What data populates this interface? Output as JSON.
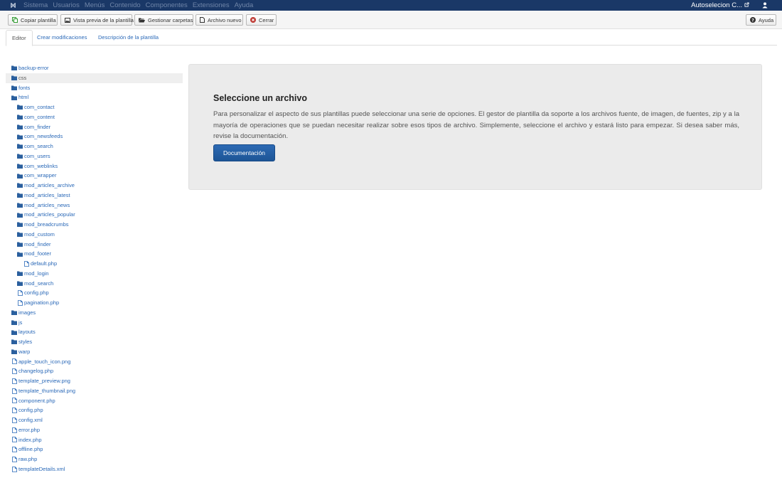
{
  "navbar": {
    "menu": [
      "Sistema",
      "Usuarios",
      "Menús",
      "Contenido",
      "Componentes",
      "Extensiones",
      "Ayuda"
    ],
    "site_name": "Autoselecion C...",
    "logo_icon": "joomla-logo-icon",
    "user_icon": "user-icon",
    "external_icon": "external-link-icon"
  },
  "toolbar": {
    "copy": "Copiar plantilla",
    "preview": "Vista previa de la plantilla",
    "folders": "Gestionar carpetas",
    "new_file": "Archivo nuevo",
    "close": "Cerrar",
    "help": "Ayuda",
    "close_icon_color": "#bd362f"
  },
  "tabs": [
    "Editor",
    "Crear modificaciones",
    "Descripción de la plantilla"
  ],
  "tree": [
    {
      "label": "backup-error",
      "type": "folder",
      "depth": 0
    },
    {
      "label": "css",
      "type": "folder",
      "depth": 0,
      "selected": true
    },
    {
      "label": "fonts",
      "type": "folder",
      "depth": 0
    },
    {
      "label": "html",
      "type": "folder",
      "depth": 0
    },
    {
      "label": "com_contact",
      "type": "folder",
      "depth": 1
    },
    {
      "label": "com_content",
      "type": "folder",
      "depth": 1
    },
    {
      "label": "com_finder",
      "type": "folder",
      "depth": 1
    },
    {
      "label": "com_newsfeeds",
      "type": "folder",
      "depth": 1
    },
    {
      "label": "com_search",
      "type": "folder",
      "depth": 1
    },
    {
      "label": "com_users",
      "type": "folder",
      "depth": 1
    },
    {
      "label": "com_weblinks",
      "type": "folder",
      "depth": 1
    },
    {
      "label": "com_wrapper",
      "type": "folder",
      "depth": 1
    },
    {
      "label": "mod_articles_archive",
      "type": "folder",
      "depth": 1
    },
    {
      "label": "mod_articles_latest",
      "type": "folder",
      "depth": 1
    },
    {
      "label": "mod_articles_news",
      "type": "folder",
      "depth": 1
    },
    {
      "label": "mod_articles_popular",
      "type": "folder",
      "depth": 1
    },
    {
      "label": "mod_breadcrumbs",
      "type": "folder",
      "depth": 1
    },
    {
      "label": "mod_custom",
      "type": "folder",
      "depth": 1
    },
    {
      "label": "mod_finder",
      "type": "folder",
      "depth": 1
    },
    {
      "label": "mod_footer",
      "type": "folder",
      "depth": 1
    },
    {
      "label": "default.php",
      "type": "file",
      "depth": 2
    },
    {
      "label": "mod_login",
      "type": "folder",
      "depth": 1
    },
    {
      "label": "mod_search",
      "type": "folder",
      "depth": 1
    },
    {
      "label": "config.php",
      "type": "file",
      "depth": 1
    },
    {
      "label": "pagination.php",
      "type": "file",
      "depth": 1
    },
    {
      "label": "images",
      "type": "folder",
      "depth": 0
    },
    {
      "label": "js",
      "type": "folder",
      "depth": 0
    },
    {
      "label": "layouts",
      "type": "folder",
      "depth": 0
    },
    {
      "label": "styles",
      "type": "folder",
      "depth": 0
    },
    {
      "label": "warp",
      "type": "folder",
      "depth": 0
    },
    {
      "label": "apple_touch_icon.png",
      "type": "file",
      "depth": 0
    },
    {
      "label": "changelog.php",
      "type": "file",
      "depth": 0
    },
    {
      "label": "template_preview.png",
      "type": "file",
      "depth": 0
    },
    {
      "label": "template_thumbnail.png",
      "type": "file",
      "depth": 0
    },
    {
      "label": "component.php",
      "type": "file",
      "depth": 0
    },
    {
      "label": "config.php",
      "type": "file",
      "depth": 0
    },
    {
      "label": "config.xml",
      "type": "file",
      "depth": 0
    },
    {
      "label": "error.php",
      "type": "file",
      "depth": 0
    },
    {
      "label": "index.php",
      "type": "file",
      "depth": 0
    },
    {
      "label": "offline.php",
      "type": "file",
      "depth": 0
    },
    {
      "label": "raw.php",
      "type": "file",
      "depth": 0
    },
    {
      "label": "templateDetails.xml",
      "type": "file",
      "depth": 0
    }
  ],
  "panel": {
    "title": "Seleccione un archivo",
    "text": "Para personalizar el aspecto de sus plantillas puede seleccionar una serie de opciones. El gestor de plantilla da soporte a los archivos fuente, de imagen, de fuentes, zip y a la mayoría de operaciones que se puedan necesitar realizar sobre esos tipos de archivo. Simplemente, seleccione el archivo y estará listo para empezar. Si desea saber más, revise la documentación.",
    "button": "Documentación"
  }
}
